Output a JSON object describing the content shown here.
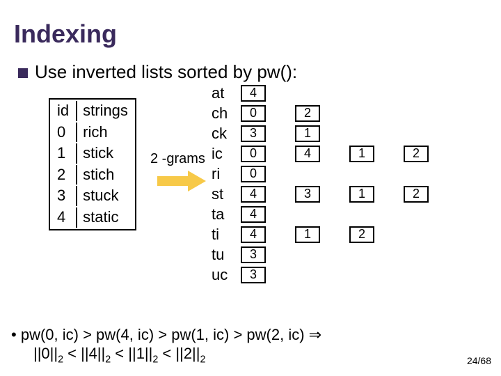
{
  "title": "Indexing",
  "subtitle": "Use inverted lists sorted by pw():",
  "table": {
    "head_id": "id",
    "head_str": "strings",
    "rows": [
      {
        "id": "0",
        "s": "rich"
      },
      {
        "id": "1",
        "s": "stick"
      },
      {
        "id": "2",
        "s": "stich"
      },
      {
        "id": "3",
        "s": "stuck"
      },
      {
        "id": "4",
        "s": "static"
      }
    ]
  },
  "grams_label": "2 -grams",
  "grams": [
    "at",
    "ch",
    "ck",
    "ic",
    "ri",
    "st",
    "ta",
    "ti",
    "tu",
    "uc"
  ],
  "lists": {
    "at": [
      "4"
    ],
    "ch": [
      "0",
      "2"
    ],
    "ck": [
      "3",
      "1"
    ],
    "ic": [
      "0",
      "4",
      "1",
      "2"
    ],
    "ri": [
      "0"
    ],
    "st": [
      "4",
      "3",
      "1",
      "2"
    ],
    "ta": [
      "4"
    ],
    "ti": [
      "4",
      "1",
      "2"
    ],
    "tu": [
      "3"
    ],
    "uc": [
      "3"
    ]
  },
  "foot_bullet": "•",
  "foot1": "pw(0, ic) > pw(4, ic) > pw(1, ic) > pw(2, ic) ⇒",
  "foot2_parts": [
    "||0||",
    "2",
    " < ||4||",
    "2",
    " < ||1||",
    "2",
    " < ||2||",
    "2"
  ],
  "page": "24/68"
}
